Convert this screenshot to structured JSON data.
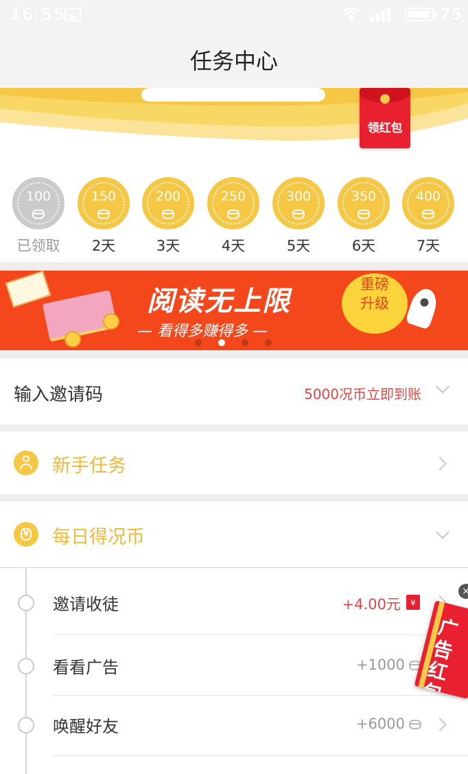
{
  "status_bar": {
    "time": "16:55",
    "battery_level": "75"
  },
  "header": {
    "title": "任务中心"
  },
  "banner": {
    "redpacket_label": "领红包"
  },
  "checkin": {
    "days": [
      {
        "value": "100",
        "label": "已领取",
        "claimed": true
      },
      {
        "value": "150",
        "label": "2天",
        "claimed": false
      },
      {
        "value": "200",
        "label": "3天",
        "claimed": false
      },
      {
        "value": "250",
        "label": "4天",
        "claimed": false
      },
      {
        "value": "300",
        "label": "5天",
        "claimed": false
      },
      {
        "value": "350",
        "label": "6天",
        "claimed": false
      },
      {
        "value": "400",
        "label": "7天",
        "claimed": false
      }
    ]
  },
  "promo": {
    "title": "阅读无上限",
    "subtitle": "— 看得多赚得多 —",
    "badge": "重磅升级"
  },
  "invite": {
    "label": "输入邀请码",
    "reward": "5000况币立即到账"
  },
  "newbie": {
    "label": "新手任务"
  },
  "daily": {
    "label": "每日得况币",
    "tasks": [
      {
        "label": "邀请收徒",
        "reward": "+4.00元",
        "reward_icon": "redpacket-icon"
      },
      {
        "label": "看看广告",
        "reward": "+1000",
        "reward_icon": "coin-icon"
      },
      {
        "label": "唤醒好友",
        "reward": "+6000",
        "reward_icon": "coin-icon"
      }
    ]
  },
  "float_ad": {
    "label": "广告红包"
  },
  "colors": {
    "accent": "#f6c744",
    "red": "#e04646",
    "promo_bg": "#f4471c"
  }
}
